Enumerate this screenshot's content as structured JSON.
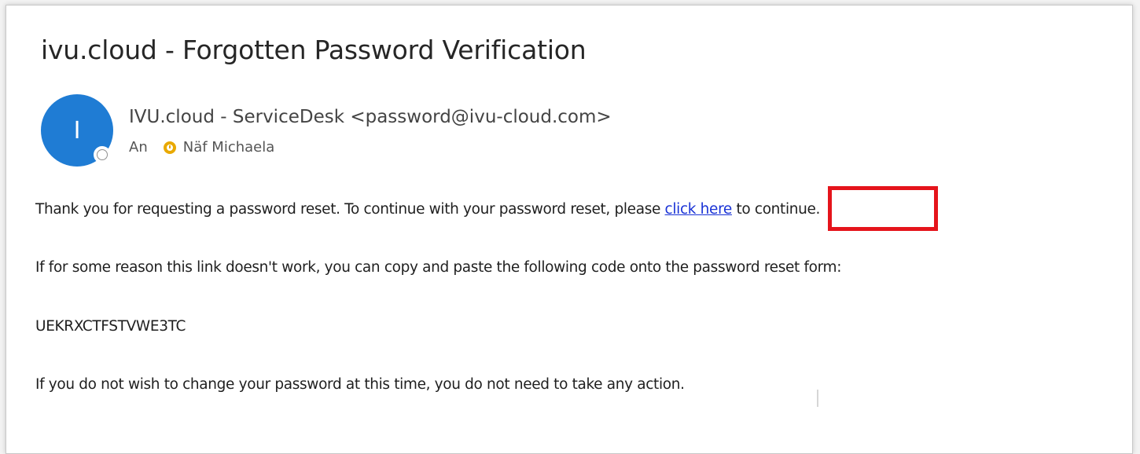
{
  "email": {
    "subject": "ivu.cloud - Forgotten Password Verification",
    "avatar_initial": "I",
    "sender": "IVU.cloud - ServiceDesk <password@ivu-cloud.com>",
    "to_label": "An",
    "recipient": "Näf Michaela",
    "paragraph1_before": "Thank you for requesting a password reset. To continue with your password reset, please ",
    "paragraph1_link": "click here",
    "paragraph1_after": " to continue.",
    "paragraph2": "If for some reason this link doesn't work, you can copy and paste the following code onto the password reset form:",
    "code": "UEKRXCTFSTVWE3TC",
    "paragraph4": "If you do not wish to change your password at this time, you do not need to take any action."
  },
  "icons": {
    "presence": "presence-status-icon",
    "recipient_status": "clock-status-icon"
  },
  "colors": {
    "avatar": "#1f7cd4",
    "link": "#1a33d6",
    "highlight": "#e5141b",
    "status_clock": "#e9a900"
  }
}
